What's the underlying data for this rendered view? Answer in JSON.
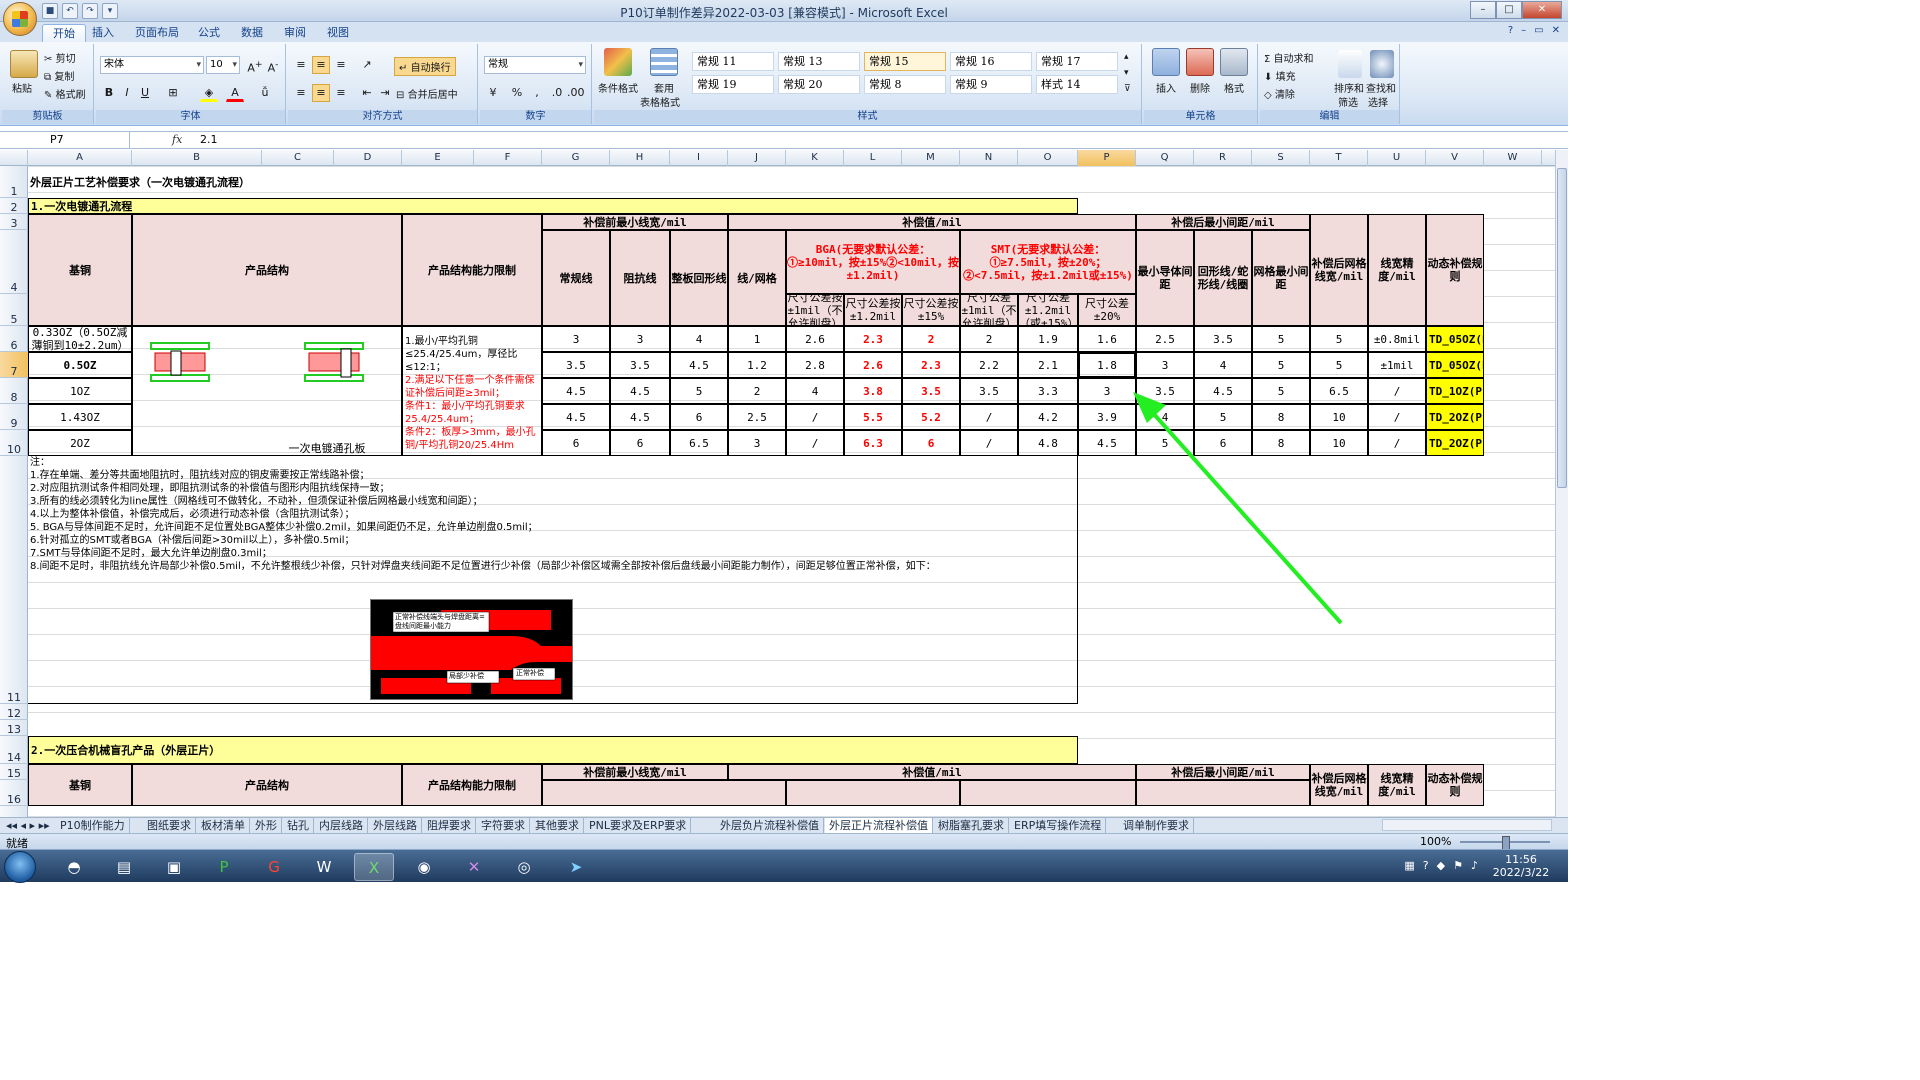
{
  "window": {
    "title": "P10订单制作差异2022-03-03  [兼容模式] - Microsoft Excel"
  },
  "ribbon_tabs": [
    "开始",
    "插入",
    "页面布局",
    "公式",
    "数据",
    "审阅",
    "视图"
  ],
  "clipboard": {
    "paste": "粘贴",
    "cut": "剪切",
    "copy": "复制",
    "format_painter": "格式刷",
    "group": "剪贴板"
  },
  "font": {
    "name": "宋体",
    "size": "10",
    "bold": "B",
    "italic": "I",
    "underline": "U",
    "group": "字体"
  },
  "alignment": {
    "wrap": "自动换行",
    "merge": "合并后居中",
    "group": "对齐方式"
  },
  "number": {
    "format": "常规",
    "group": "数字"
  },
  "styles": {
    "cond_format": "条件格式",
    "table_format_1": "套用",
    "table_format_2": "表格格式",
    "cells": [
      "常规 11",
      "常规 13",
      "常规 15",
      "常规 16",
      "常规 17",
      "常规 19",
      "常规 20",
      "常规 8",
      "常规 9",
      "样式 14"
    ],
    "group": "样式"
  },
  "cells_group": {
    "insert": "插入",
    "delete": "删除",
    "format": "格式",
    "group": "单元格"
  },
  "editing": {
    "autosum": "自动求和",
    "fill": "填充",
    "clear": "清除",
    "sort_1": "排序和",
    "sort_2": "筛选",
    "find_1": "查找和",
    "find_2": "选择",
    "group": "编辑"
  },
  "formula_bar": {
    "cell_ref": "P7",
    "fx": "fx",
    "value": "2.1"
  },
  "columns": [
    "A",
    "B",
    "C",
    "D",
    "E",
    "F",
    "G",
    "H",
    "I",
    "J",
    "K",
    "L",
    "M",
    "N",
    "O",
    "P",
    "Q",
    "R",
    "S",
    "T",
    "U",
    "V",
    "W"
  ],
  "rows": [
    "1",
    "2",
    "3",
    "4",
    "5",
    "6",
    "7",
    "8",
    "9",
    "10",
    "11",
    "12",
    "13",
    "14",
    "15",
    "16"
  ],
  "sheet": {
    "title": "外层正片工艺补偿要求（一次电镀通孔流程）",
    "section1": "1.一次电镀通孔流程",
    "section2": "2.一次压合机械盲孔产品（外层正片）",
    "h_base_copper": "基铜",
    "h_structure": "产品结构",
    "h_limit": "产品结构能力限制",
    "h_min_width_pre": "补偿前最小线宽/mil",
    "h_comp": "补偿值/mil",
    "h_min_space_post": "补偿后最小间距/mil",
    "h_normal_line": "常规线",
    "h_impedance": "阻抗线",
    "h_whole_ring": "整板回形线",
    "h_line_mesh": "线/网格",
    "h_bga": "BGA(无要求默认公差：①≥10mil，按±15%②<10mil，按±1.2mil)",
    "h_smt": "SMT(无要求默认公差：①≥7.5mil，按±20%；②<7.5mil，按±1.2mil或±15%)",
    "h_bga_1": "尺寸公差按±1mil（不允许削盘）",
    "h_bga_2": "尺寸公差按±1.2mil",
    "h_bga_3": "尺寸公差按±15%",
    "h_smt_1": "尺寸公差±1mil（不允许削盘）",
    "h_smt_2": "尺寸公差±1.2mil（或±15%）",
    "h_smt_3": "尺寸公差±20%",
    "h_min_cond": "最小导体间距",
    "h_ring_snake": "回形线/蛇形线/线圈",
    "h_mesh_min": "网格最小间距",
    "h_post_mesh_width": "补偿后网格线宽/mil",
    "h_width_precision": "线宽精度/mil",
    "h_dynamic": "动态补偿规则",
    "structure_caption": "一次电镀通孔板",
    "limit_text_1": "1.最小/平均孔铜≤25.4/25.4um，厚径比≤12:1；",
    "limit_text_2": "2.满足以下任意一个条件需保证补偿后间距≥3mil；",
    "limit_text_3": "条件1：最小/平均孔铜要求25.4/25.4um；",
    "limit_text_4": "条件2：板厚>3mm，最小孔铜/平均孔铜20/25.4Hm",
    "data_rows": [
      {
        "base": "0.33OZ（0.5OZ减薄铜到10±2.2um）",
        "v": [
          "3",
          "3",
          "4",
          "1",
          "2.6",
          "2.3",
          "2",
          "2",
          "1.9",
          "1.6",
          "2.5",
          "3.5",
          "5",
          "5",
          "±0.8mil",
          "TD_05OZ(P10)"
        ]
      },
      {
        "base": "0.5OZ",
        "v": [
          "3.5",
          "3.5",
          "4.5",
          "1.2",
          "2.8",
          "2.6",
          "2.3",
          "2.2",
          "2.1",
          "1.8",
          "3",
          "4",
          "5",
          "5",
          "±1mil",
          "TD_05OZ(P10)"
        ]
      },
      {
        "base": "1OZ",
        "v": [
          "4.5",
          "4.5",
          "5",
          "2",
          "4",
          "3.8",
          "3.5",
          "3.5",
          "3.3",
          "3",
          "3.5",
          "4.5",
          "5",
          "6.5",
          "/",
          "TD_1OZ(P10)"
        ]
      },
      {
        "base": "1.43OZ",
        "v": [
          "4.5",
          "4.5",
          "6",
          "2.5",
          "/",
          "5.5",
          "5.2",
          "/",
          "4.2",
          "3.9",
          "4",
          "5",
          "8",
          "10",
          "/",
          "TD_2OZ(P10)"
        ]
      },
      {
        "base": "2OZ",
        "v": [
          "6",
          "6",
          "6.5",
          "3",
          "/",
          "6.3",
          "6",
          "/",
          "4.8",
          "4.5",
          "5",
          "6",
          "8",
          "10",
          "/",
          "TD_2OZ(P10)"
        ]
      }
    ],
    "notes": [
      "注：",
      "1.存在单端、差分等共面地阻抗时，阻抗线对应的铜皮需要按正常线路补偿；",
      "2.对应阻抗测试条件相同处理，即阻抗测试条的补偿值与图形内阻抗线保持一致；",
      "3.所有的线必须转化为line属性（网格线可不做转化，不动补，但须保证补偿后网格最小线宽和间距）；",
      "4.以上为整体补偿值，补偿完成后，必须进行动态补偿（含阻抗测试条）；",
      "5. BGA与导体间距不足时，允许间距不足位置处BGA整体少补偿0.2mil，如果间距仍不足，允许单边削盘0.5mil；",
      "6.针对孤立的SMT或者BGA（补偿后间距>30mil以上），多补偿0.5mil；",
      "7.SMT与导体间距不足时，最大允许单边削盘0.3mil；",
      "8.间距不足时，非阻抗线允许局部少补偿0.5mil，不允许整根线少补偿，只针对焊盘夹线间距不足位置进行少补偿（局部少补偿区域需全部按补偿后盘线最小间距能力制作），间距足够位置正常补偿，如下："
    ],
    "img_label_1": "正常补偿线端头与焊盘距离=盘线间距最小能力",
    "img_label_2": "局部少补偿",
    "img_label_3": "正常补偿"
  },
  "sheet_tabs": [
    "P10制作能力",
    "图纸要求",
    "板材清单",
    "外形",
    "钻孔",
    "内层线路",
    "外层线路",
    "阻焊要求",
    "字符要求",
    "其他要求",
    "PNL要求及ERP要求",
    "外层负片流程补偿值",
    "外层正片流程补偿值",
    "树脂塞孔要求",
    "ERP填写操作流程",
    "调单制作要求"
  ],
  "active_sheet_tab": "外层正片流程补偿值",
  "status": {
    "ready": "就绪",
    "zoom": "100%"
  },
  "clock": {
    "time": "11:56",
    "date": "2022/3/22"
  },
  "colors": {
    "accent": "#15428b",
    "header_pink": "#f2dcdb",
    "section_yellow": "#ffff99",
    "arrow_green": "#22ee22"
  }
}
